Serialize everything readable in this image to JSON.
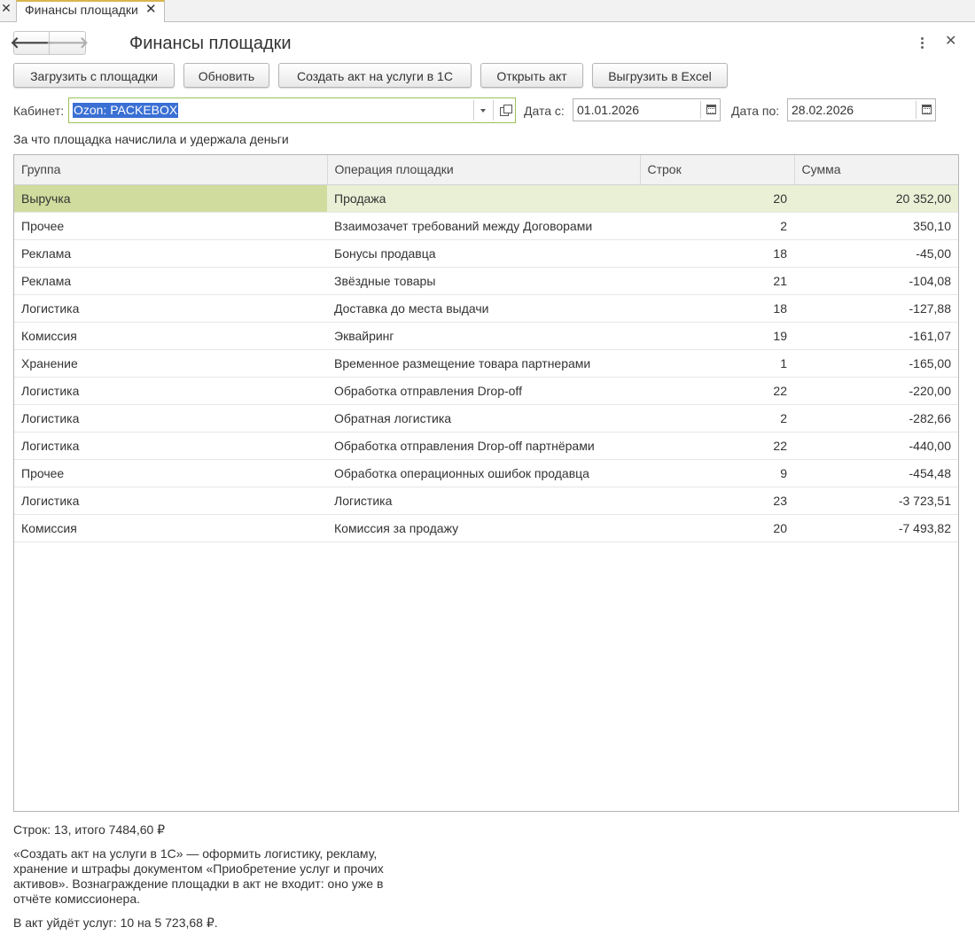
{
  "window": {
    "tab_title": "Финансы площадки",
    "tab_close": "✕",
    "left_close": "✕"
  },
  "header": {
    "title": "Финансы площадки",
    "back_icon": "🡐",
    "forward_icon": "🡒",
    "close_icon": "✕"
  },
  "toolbar": {
    "load": "Загрузить с площадки",
    "refresh": "Обновить",
    "create_act": "Создать акт на услуги в 1С",
    "open_act": "Открыть акт",
    "export_excel": "Выгрузить в Excel"
  },
  "filters": {
    "cabinet_label": "Кабинет:",
    "cabinet_value": "Ozon: PACKEBOX",
    "date_from_label": "Дата с:",
    "date_from": "01.01.2026",
    "date_to_label": "Дата по:",
    "date_to": "28.02.2026"
  },
  "section_caption": "За что площадка начислила и удержала деньги",
  "table": {
    "columns": [
      "Группа",
      "Операция площадки",
      "Строк",
      "Сумма"
    ],
    "rows": [
      {
        "group": "Выручка",
        "operation": "Продажа",
        "count": "20",
        "sum": "20 352,00"
      },
      {
        "group": "Прочее",
        "operation": "Взаимозачет требований между Договорами",
        "count": "2",
        "sum": "350,10"
      },
      {
        "group": "Реклама",
        "operation": "Бонусы продавца",
        "count": "18",
        "sum": "-45,00"
      },
      {
        "group": "Реклама",
        "operation": "Звёздные товары",
        "count": "21",
        "sum": "-104,08"
      },
      {
        "group": "Логистика",
        "operation": "Доставка до места выдачи",
        "count": "18",
        "sum": "-127,88"
      },
      {
        "group": "Комиссия",
        "operation": "Эквайринг",
        "count": "19",
        "sum": "-161,07"
      },
      {
        "group": "Хранение",
        "operation": "Временное размещение товара партнерами",
        "count": "1",
        "sum": "-165,00"
      },
      {
        "group": "Логистика",
        "operation": "Обработка отправления Drop-off",
        "count": "22",
        "sum": "-220,00"
      },
      {
        "group": "Логистика",
        "operation": "Обратная логистика",
        "count": "2",
        "sum": "-282,66"
      },
      {
        "group": "Логистика",
        "operation": "Обработка отправления Drop-off партнёрами",
        "count": "22",
        "sum": "-440,00"
      },
      {
        "group": "Прочее",
        "operation": "Обработка операционных ошибок продавца",
        "count": "9",
        "sum": "-454,48"
      },
      {
        "group": "Логистика",
        "operation": "Логистика",
        "count": "23",
        "sum": "-3 723,51"
      },
      {
        "group": "Комиссия",
        "operation": "Комиссия за продажу",
        "count": "20",
        "sum": "-7 493,82"
      }
    ]
  },
  "footer": {
    "summary": "Строк: 13, итого 7484,60 ₽",
    "note": "«Создать акт на услуги в 1С» — оформить логистику, рекламу, хранение и штрафы документом «Приобретение услуг и прочих активов». Вознаграждение площадки в акт не входит: оно уже в отчёте комиссионера.",
    "act_total": "В акт уйдёт услуг: 10 на 5 723,68 ₽."
  },
  "colors": {
    "selected_row": "#eaf0d6",
    "selected_cell": "#cfdc9e",
    "selection_text": "#3a6fd4",
    "tab_accent": "#d9b64d"
  }
}
